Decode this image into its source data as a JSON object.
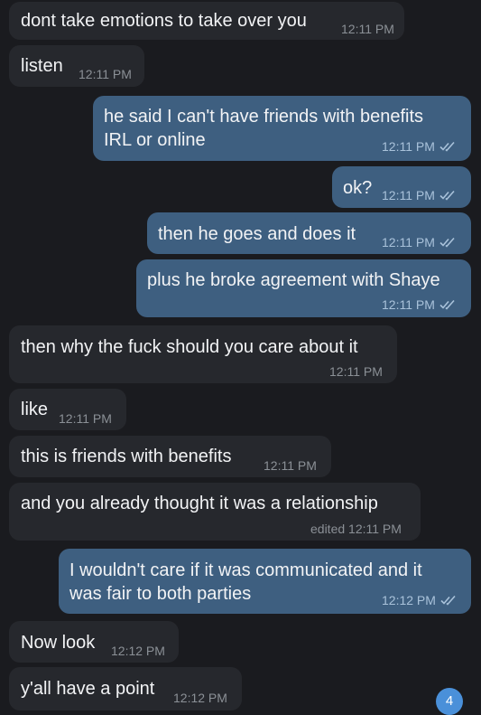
{
  "messages": [
    {
      "text": "dont take emotions to take over you",
      "time": "12:11 PM"
    },
    {
      "text": "listen",
      "time": "12:11 PM"
    },
    {
      "line1": "he said I can't have friends with benefits",
      "line2": "IRL or online",
      "time": "12:11 PM"
    },
    {
      "text": "ok?",
      "time": "12:11 PM"
    },
    {
      "text": "then he goes and does it",
      "time": "12:11 PM"
    },
    {
      "text": "plus he broke agreement with Shaye",
      "time": "12:11 PM"
    },
    {
      "text": "then why the fuck should you care about it",
      "time": "12:11 PM"
    },
    {
      "text": "like",
      "time": "12:11 PM"
    },
    {
      "text": "this is friends with benefits",
      "time": "12:11 PM"
    },
    {
      "text": "and you already thought it was a relationship",
      "time": "edited 12:11 PM"
    },
    {
      "line1": "I wouldn't care if it was communicated and it",
      "line2": "was fair to both parties",
      "time": "12:12 PM"
    },
    {
      "text": "Now look",
      "time": "12:12 PM"
    },
    {
      "text": "y'all have a point",
      "time": "12:12 PM"
    }
  ],
  "unread_badge": "4",
  "colors": {
    "background": "#1a1b1f",
    "incoming": "#26282d",
    "outgoing": "#3e5f80",
    "badge": "#4a90d9"
  },
  "icons": {
    "read_receipt": "double-check-icon"
  }
}
